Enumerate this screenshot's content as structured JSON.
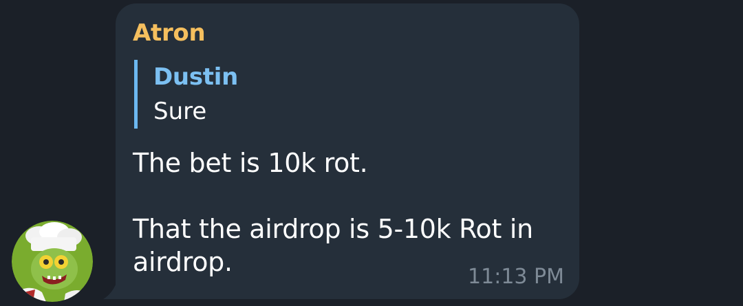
{
  "avatar": {
    "icon": "zombie-chef-avatar-icon"
  },
  "message": {
    "sender": "Atron",
    "reply_to": {
      "name": "Dustin",
      "text": "Sure"
    },
    "text": "The bet is 10k rot.\n\nThat the airdrop is 5-10k Rot in\nairdrop.",
    "time": "11:13 PM"
  },
  "colors": {
    "background": "#1b2028",
    "bubble": "#252f3a",
    "sender_name": "#f5bf5e",
    "reply_accent": "#6cb8f0",
    "timestamp": "#7e8a96"
  }
}
